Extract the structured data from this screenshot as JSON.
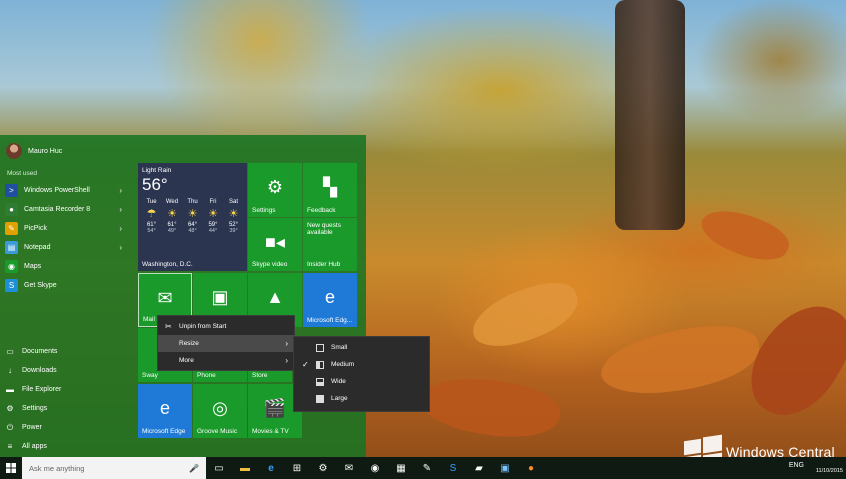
{
  "start_menu": {
    "user_name": "Mauro Huc",
    "most_used_label": "Most used",
    "apps": [
      {
        "label": "Windows PowerShell",
        "icon": "powershell-icon",
        "glyph": ">",
        "color": "#1f4f9e",
        "has_arrow": true
      },
      {
        "label": "Camtasia Recorder 8",
        "icon": "camtasia-icon",
        "glyph": "●",
        "color": "#2e7d32",
        "has_arrow": true
      },
      {
        "label": "PicPick",
        "icon": "picpick-icon",
        "glyph": "✎",
        "color": "#e0a000",
        "has_arrow": true
      },
      {
        "label": "Notepad",
        "icon": "notepad-icon",
        "glyph": "▤",
        "color": "#3a9bd8",
        "has_arrow": true
      },
      {
        "label": "Maps",
        "icon": "maps-icon",
        "glyph": "◉",
        "color": "#1a9a2a",
        "has_arrow": false
      },
      {
        "label": "Get Skype",
        "icon": "skype-icon",
        "glyph": "S",
        "color": "#1e8fd6",
        "has_arrow": false
      }
    ],
    "bottom": [
      {
        "label": "Documents",
        "icon": "documents-icon",
        "glyph": "▭"
      },
      {
        "label": "Downloads",
        "icon": "downloads-icon",
        "glyph": "↓"
      },
      {
        "label": "File Explorer",
        "icon": "file-explorer-icon",
        "glyph": "▬"
      },
      {
        "label": "Settings",
        "icon": "gear-icon",
        "glyph": "⚙"
      },
      {
        "label": "Power",
        "icon": "power-icon",
        "glyph": "⏻"
      },
      {
        "label": "All apps",
        "icon": "all-apps-icon",
        "glyph": "≡"
      }
    ]
  },
  "weather": {
    "condition": "Light Rain",
    "temp": "56°",
    "city": "Washington, D.C.",
    "days": [
      {
        "name": "Tue",
        "symbol": "☂",
        "hi": "61°",
        "lo": "54°"
      },
      {
        "name": "Wed",
        "symbol": "☀",
        "hi": "61°",
        "lo": "49°"
      },
      {
        "name": "Thu",
        "symbol": "☀",
        "hi": "64°",
        "lo": "48°"
      },
      {
        "name": "Fri",
        "symbol": "☀",
        "hi": "59°",
        "lo": "44°"
      },
      {
        "name": "Sat",
        "symbol": "☀",
        "hi": "52°",
        "lo": "39°"
      }
    ]
  },
  "tiles": {
    "settings": "Settings",
    "feedback": "Feedback",
    "new_quests": "New quests available",
    "skype_video": "Skype video",
    "insider_hub": "Insider Hub",
    "mail": "Mail",
    "edge_small": "Microsoft Edg...",
    "sway": "Sway",
    "phone": "Phone",
    "store": "Store",
    "edge_large": "Microsoft Edge",
    "groove": "Groove Music",
    "movies": "Movies & TV"
  },
  "context_menu": {
    "unpin": "Unpin from Start",
    "resize": "Resize",
    "more": "More"
  },
  "resize_menu": {
    "selected": "Medium",
    "options": [
      "Small",
      "Medium",
      "Wide",
      "Large"
    ]
  },
  "taskbar": {
    "search_placeholder": "Ask me anything",
    "language": "ENG",
    "date": "11/10/2015"
  },
  "watermark": {
    "text": "Windows Central"
  },
  "colors": {
    "accent_green": "#1a9a2a",
    "edge_blue": "#1e7ad6",
    "menu_dark": "#2b2b2b"
  }
}
